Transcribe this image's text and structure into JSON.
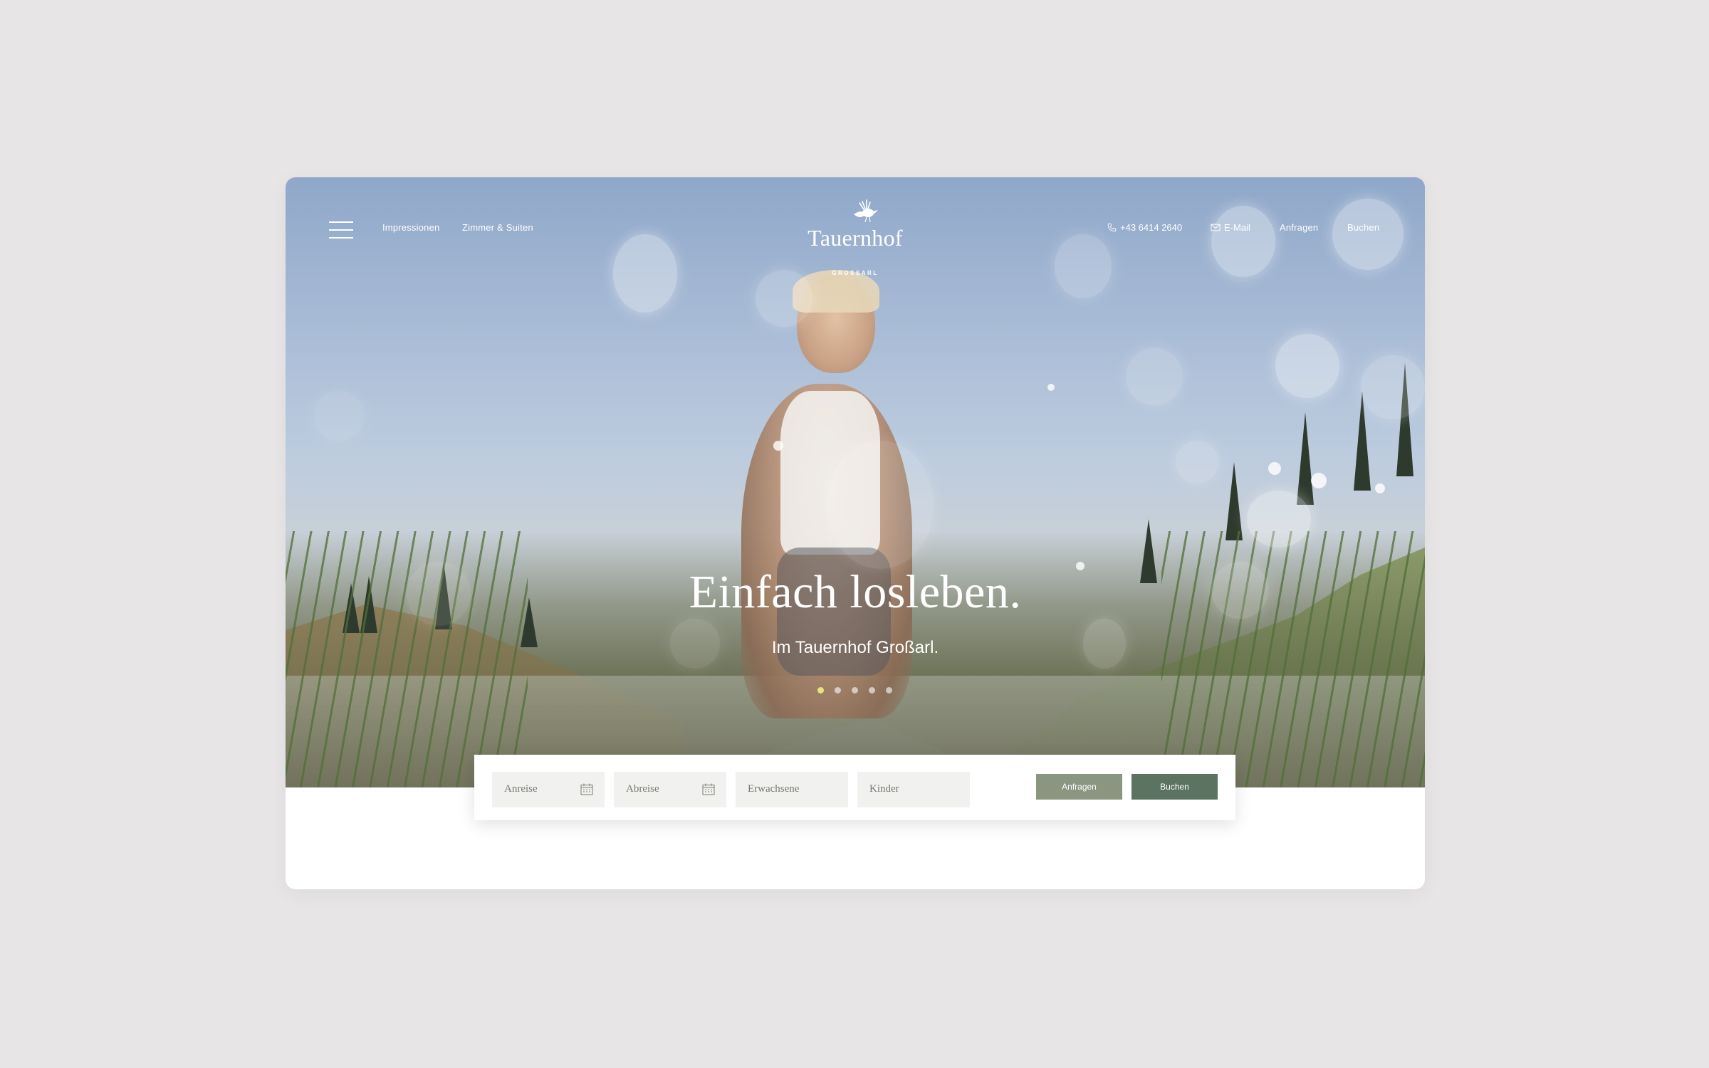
{
  "nav": {
    "menu_icon": "hamburger-menu-icon",
    "links": [
      "Impressionen",
      "Zimmer & Suiten"
    ]
  },
  "logo": {
    "name": "Tauernhof",
    "subtitle": "GROSSARL",
    "icon": "bird-logo-icon"
  },
  "contact": {
    "phone": "+43 6414 2640",
    "phone_icon": "phone-icon",
    "email": "E-Mail",
    "email_icon": "mail-icon",
    "inquire": "Anfragen",
    "book": "Buchen"
  },
  "hero": {
    "headline": "Einfach losleben.",
    "subline": "Im Tauernhof Großarl.",
    "slides_total": 5,
    "active_slide": 1
  },
  "booking": {
    "arrival_placeholder": "Anreise",
    "departure_placeholder": "Abreise",
    "adults_placeholder": "Erwachsene",
    "children_placeholder": "Kinder",
    "calendar_icon": "calendar-icon",
    "inquire_label": "Anfragen",
    "book_label": "Buchen"
  },
  "colors": {
    "page_background": "#e7e5e6",
    "inquire_button": "#8a9680",
    "book_button": "#5b7360",
    "active_dot": "#e8e27a"
  }
}
